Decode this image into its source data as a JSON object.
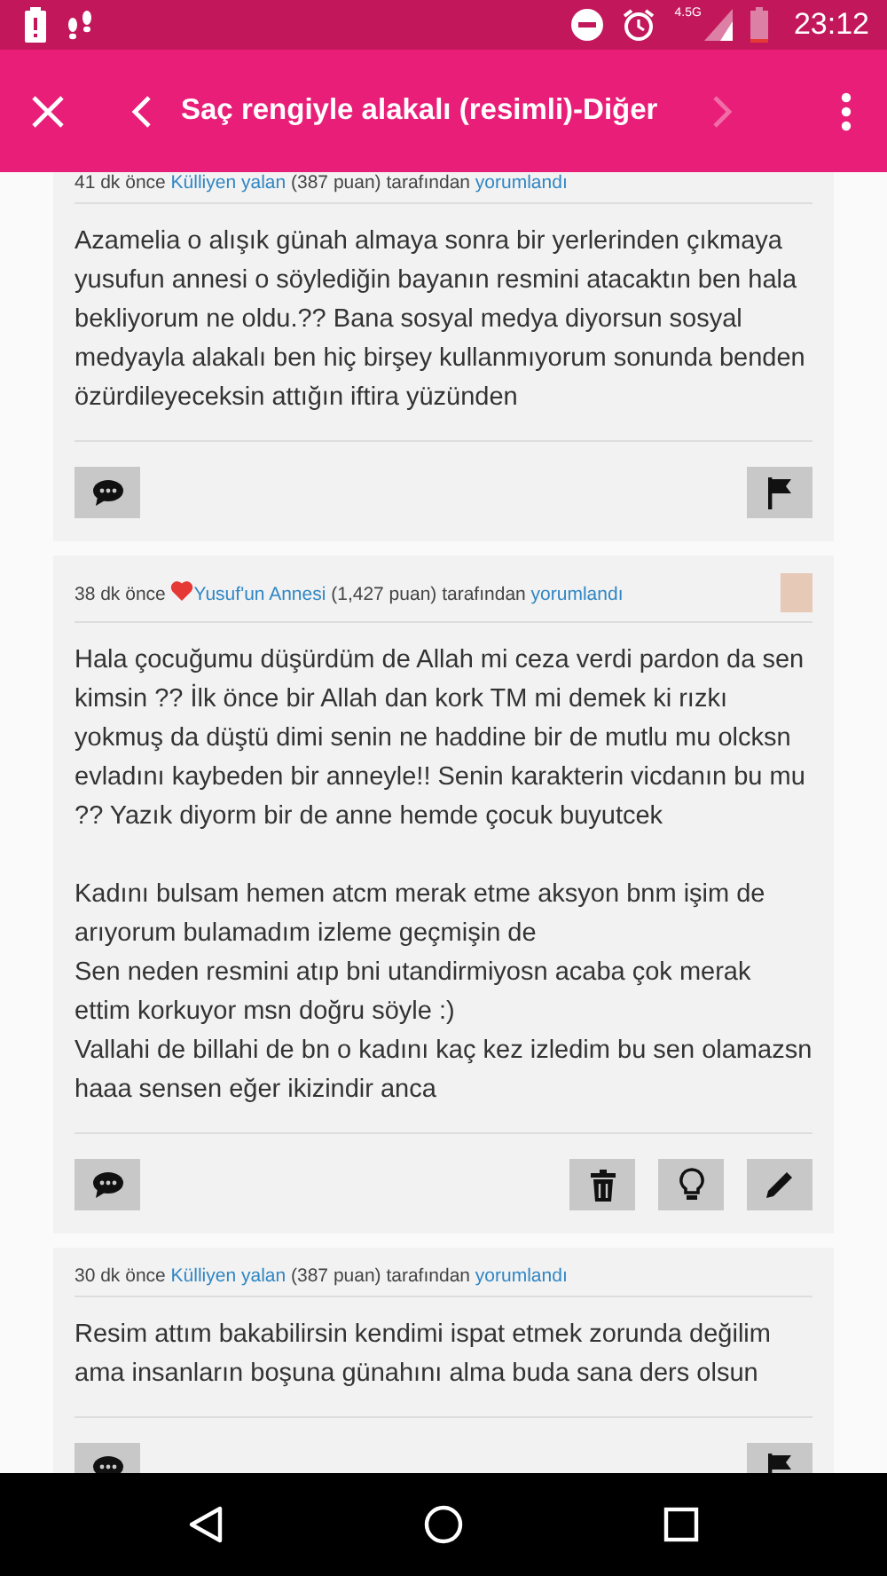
{
  "status_bar": {
    "network": "4.5G",
    "time": "23:12"
  },
  "app_bar": {
    "title": "Saç rengiyle alakalı (resimli)-Diğer",
    "previous_disabled": false,
    "next_disabled": true
  },
  "comments": [
    {
      "time": "41 dk önce",
      "heart": false,
      "user": "Külliyen yalan",
      "points": "(387 puan) tarafından",
      "action": "yorumlandı",
      "avatar": false,
      "text": "Azamelia o alışık günah almaya sonra bir yerlerinden çıkmaya yusufun annesi o söylediğin bayanın resmini atacaktın ben hala bekliyorum ne oldu.?? Bana sosyal medya diyorsun sosyal medyayla alakalı ben hiç birşey kullanmıyorum sonunda benden özürdileyeceksin attığın iftira yüzünden",
      "actions": [
        {
          "kind": "reply"
        },
        {
          "kind": "flag"
        }
      ]
    },
    {
      "time": "38 dk önce",
      "heart": true,
      "user": "Yusuf'un Annesi",
      "points": "(1,427 puan) tarafından",
      "action": "yorumlandı",
      "avatar": true,
      "text": "Hala çocuğumu düşürdüm de Allah mi ceza verdi pardon da sen kimsin ?? İlk önce bir Allah dan kork TM mi demek ki rızkı yokmuş da düştü dimi senin ne haddine bir de mutlu mu olcksn evladını kaybeden bir anneyle!! Senin karakterin vicdanın bu mu ?? Yazık diyorm bir de anne hemde çocuk buyutcek\n\nKadını bulsam hemen atcm merak etme aksyon bnm işim de arıyorum bulamadım izleme geçmişin de\nSen neden resmini atıp bni utandirmiyosn acaba çok merak ettim korkuyor msn doğru söyle :)\nVallahi de billahi de bn o kadını kaç kez izledim bu sen olamazsn haaa sensen eğer ikizindir anca",
      "actions": [
        {
          "kind": "reply"
        },
        {
          "kind": "delete"
        },
        {
          "kind": "idea"
        },
        {
          "kind": "edit"
        }
      ]
    },
    {
      "time": "30 dk önce",
      "heart": false,
      "user": "Külliyen yalan",
      "points": "(387 puan) tarafından",
      "action": "yorumlandı",
      "avatar": false,
      "text": "Resim attım bakabilirsin kendimi ispat etmek zorunda değilim ama insanların boşuna günahını alma buda sana ders olsun",
      "actions": [
        {
          "kind": "reply"
        },
        {
          "kind": "flag"
        }
      ]
    }
  ]
}
